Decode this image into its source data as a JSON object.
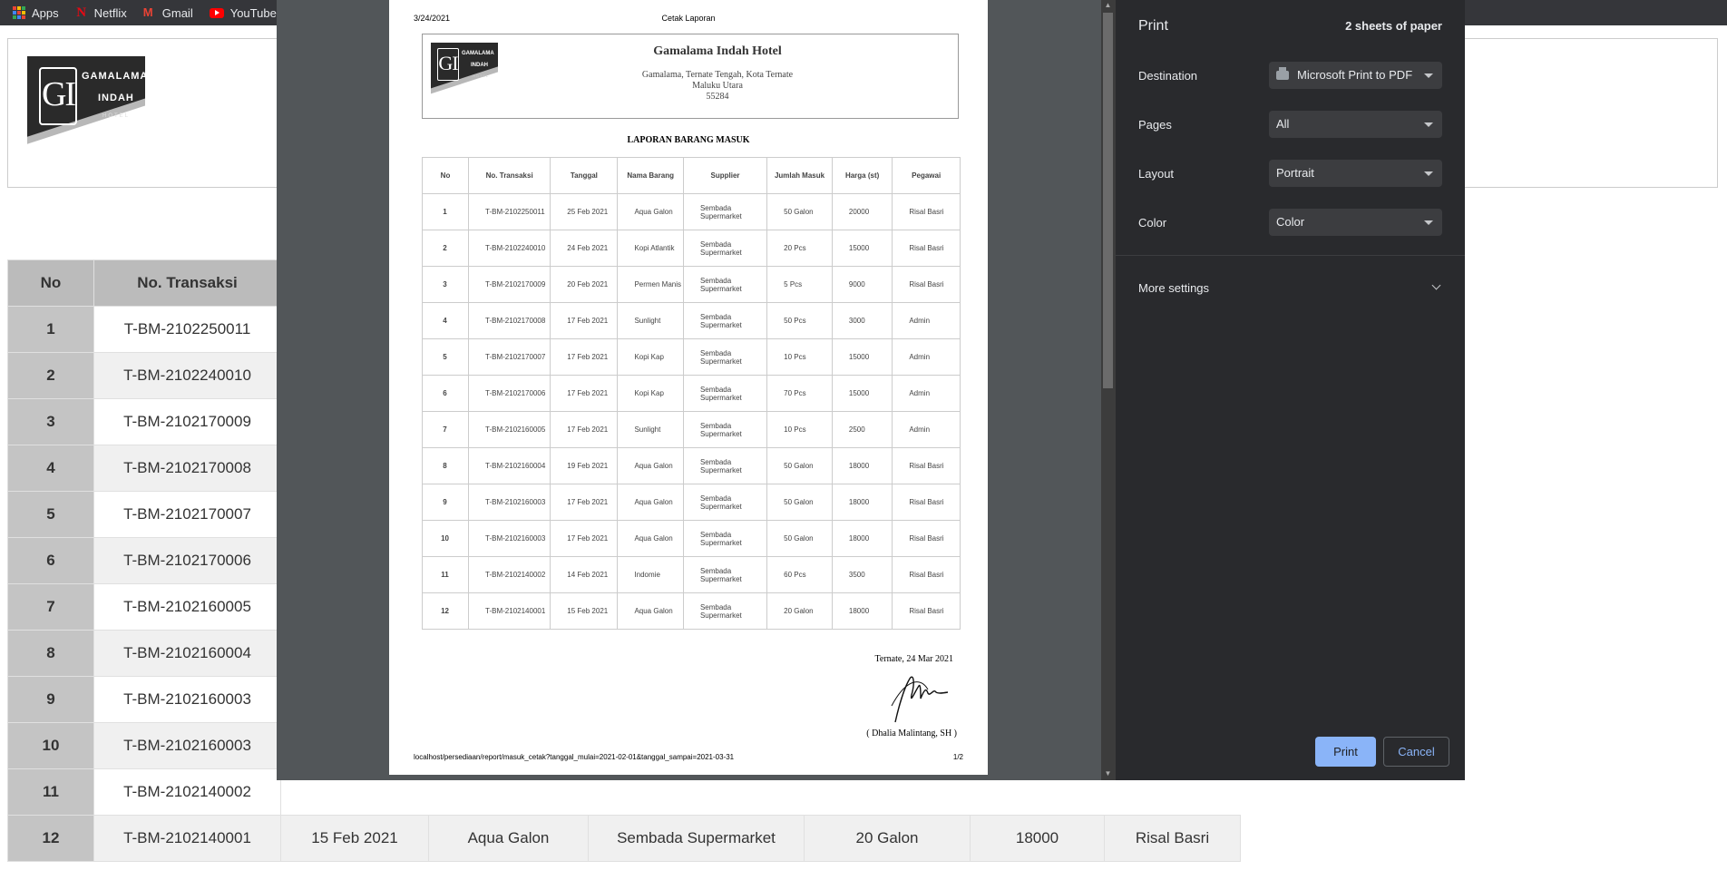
{
  "bookmarks": [
    {
      "label": "Apps",
      "icon": "apps-icon"
    },
    {
      "label": "Netflix",
      "icon": "netflix-icon"
    },
    {
      "label": "Gmail",
      "icon": "gmail-icon"
    },
    {
      "label": "YouTube",
      "icon": "youtube-icon"
    }
  ],
  "logo": {
    "letters": "GI",
    "line1": "GAMALAMA",
    "line2": "INDAH",
    "line3": "HOTEL"
  },
  "background_table": {
    "headers": [
      "No",
      "No. Transaksi"
    ],
    "rows": [
      [
        "1",
        "T-BM-2102250011"
      ],
      [
        "2",
        "T-BM-2102240010"
      ],
      [
        "3",
        "T-BM-2102170009"
      ],
      [
        "4",
        "T-BM-2102170008"
      ],
      [
        "5",
        "T-BM-2102170007"
      ],
      [
        "6",
        "T-BM-2102170006"
      ],
      [
        "7",
        "T-BM-2102160005"
      ],
      [
        "8",
        "T-BM-2102160004"
      ],
      [
        "9",
        "T-BM-2102160003"
      ],
      [
        "10",
        "T-BM-2102160003"
      ],
      [
        "11",
        "T-BM-2102140002"
      ],
      [
        "12",
        "T-BM-2102140001",
        "15 Feb 2021",
        "Aqua Galon",
        "Sembada Supermarket",
        "20 Galon",
        "18000",
        "Risal Basri"
      ]
    ]
  },
  "paper": {
    "date": "3/24/2021",
    "header_title": "Cetak Laporan",
    "hotel_name": "Gamalama Indah Hotel",
    "address1": "Gamalama, Ternate Tengah, Kota Ternate",
    "address2": "Maluku Utara",
    "address3": "55284",
    "report_title": "LAPORAN BARANG MASUK",
    "table_headers": [
      "No",
      "No. Transaksi",
      "Tanggal",
      "Nama Barang",
      "Supplier",
      "Jumlah Masuk",
      "Harga (st)",
      "Pegawai"
    ],
    "rows": [
      [
        "1",
        "T-BM-2102250011",
        "25 Feb 2021",
        "Aqua Galon",
        "Sembada Supermarket",
        "50 Galon",
        "20000",
        "Risal Basri"
      ],
      [
        "2",
        "T-BM-2102240010",
        "24 Feb 2021",
        "Kopi Atlantik",
        "Sembada Supermarket",
        "20 Pcs",
        "15000",
        "Risal Basri"
      ],
      [
        "3",
        "T-BM-2102170009",
        "20 Feb 2021",
        "Permen Manis",
        "Sembada Supermarket",
        "5 Pcs",
        "9000",
        "Risal Basri"
      ],
      [
        "4",
        "T-BM-2102170008",
        "17 Feb 2021",
        "Sunlight",
        "Sembada Supermarket",
        "50 Pcs",
        "3000",
        "Admin"
      ],
      [
        "5",
        "T-BM-2102170007",
        "17 Feb 2021",
        "Kopi Kap",
        "Sembada Supermarket",
        "10 Pcs",
        "15000",
        "Admin"
      ],
      [
        "6",
        "T-BM-2102170006",
        "17 Feb 2021",
        "Kopi Kap",
        "Sembada Supermarket",
        "70 Pcs",
        "15000",
        "Admin"
      ],
      [
        "7",
        "T-BM-2102160005",
        "17 Feb 2021",
        "Sunlight",
        "Sembada Supermarket",
        "10 Pcs",
        "2500",
        "Admin"
      ],
      [
        "8",
        "T-BM-2102160004",
        "19 Feb 2021",
        "Aqua Galon",
        "Sembada Supermarket",
        "50 Galon",
        "18000",
        "Risal Basri"
      ],
      [
        "9",
        "T-BM-2102160003",
        "17 Feb 2021",
        "Aqua Galon",
        "Sembada Supermarket",
        "50 Galon",
        "18000",
        "Risal Basri"
      ],
      [
        "10",
        "T-BM-2102160003",
        "17 Feb 2021",
        "Aqua Galon",
        "Sembada Supermarket",
        "50 Galon",
        "18000",
        "Risal Basri"
      ],
      [
        "11",
        "T-BM-2102140002",
        "14 Feb 2021",
        "Indomie",
        "Sembada Supermarket",
        "60 Pcs",
        "3500",
        "Risal Basri"
      ],
      [
        "12",
        "T-BM-2102140001",
        "15 Feb 2021",
        "Aqua Galon",
        "Sembada Supermarket",
        "20 Galon",
        "18000",
        "Risal Basri"
      ]
    ],
    "sign_place_date": "Ternate, 24 Mar 2021",
    "sign_name": "( Dhalia Malintang, SH )",
    "footer_url": "localhost/persediaan/report/masuk_cetak?tanggal_mulai=2021-02-01&tanggal_sampai=2021-03-31",
    "page_number": "1/2"
  },
  "print_settings": {
    "title": "Print",
    "sheets": "2 sheets of paper",
    "destination_label": "Destination",
    "destination_value": "Microsoft Print to PDF",
    "pages_label": "Pages",
    "pages_value": "All",
    "layout_label": "Layout",
    "layout_value": "Portrait",
    "color_label": "Color",
    "color_value": "Color",
    "more_settings": "More settings",
    "print_button": "Print",
    "cancel_button": "Cancel"
  },
  "colors": {
    "accent": "#8ab4f8",
    "dialog_bg": "#292a2d",
    "preview_bg": "#525659"
  }
}
